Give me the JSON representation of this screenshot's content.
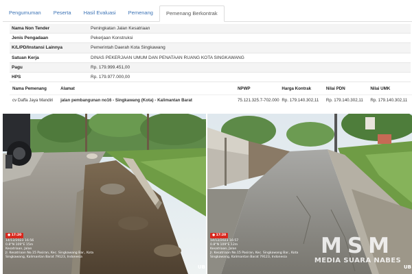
{
  "tabs": [
    {
      "label": "Pengumuman",
      "active": false
    },
    {
      "label": "Peserta",
      "active": false
    },
    {
      "label": "Hasil Evaluasi",
      "active": false
    },
    {
      "label": "Pemenang",
      "active": false
    },
    {
      "label": "Pemenang Berkontrak",
      "active": true
    }
  ],
  "info": [
    {
      "label": "Nama Non Tender",
      "value": "Peningkatan Jalan Kesatriaan"
    },
    {
      "label": "Jenis Pengadaan",
      "value": "Pekerjaan Konstruksi"
    },
    {
      "label": "K/L/PD/Instansi Lainnya",
      "value": "Pemerintah Daerah Kota Singkawang"
    },
    {
      "label": "Satuan Kerja",
      "value": "DINAS PEKERJAAN UMUM DAN PENATAAN RUANG KOTA SINGKAWANG"
    },
    {
      "label": "Pagu",
      "value": "Rp. 179.999.451,00"
    },
    {
      "label": "HPS",
      "value": "Rp. 179.977.000,00"
    }
  ],
  "winner_table": {
    "headers": [
      "Nama Pemenang",
      "Alamat",
      "NPWP",
      "Harga Kontrak",
      "Nilai PDN",
      "Nilai UMK"
    ],
    "rows": [
      {
        "nama": "cv Daffa Jaya Mandiri",
        "alamat": "jalan pembangunan no16 - Singkawang (Kota) - Kalimantan Barat",
        "npwp": "75.121.325.7-702.000",
        "harga": "Rp. 179.140.302,11",
        "pdn": "Rp. 179.140.302,11",
        "umk": "Rp. 179.140.302,11"
      }
    ]
  },
  "photos": {
    "left_stamp": {
      "badge": "● 17:20",
      "lines": [
        "14/12/2023 16:56",
        "0.8°N 109°E 15m",
        "Kesatriaan, Jalan",
        "Jl. Kesatriaan No.15 Pasiran, Kec. Singkawang Bar., Kota",
        "Singkawang, Kalimantan Barat 79123, Indonesia"
      ]
    },
    "right_stamp": {
      "badge": "● 17:20",
      "lines": [
        "14/12/2023 16:57",
        "0.8°N 109°E 12m",
        "Kesatriaan, Jalan",
        "Jl. Kesatriaan No.15 Pasiran, Kec. Singkawang Bar., Kota",
        "Singkawang, Kalimantan Barat 79123, Indonesia"
      ]
    },
    "logo_mark": "UB"
  },
  "watermark": {
    "big": "MSM",
    "small": "MEDIA SUARA NABES"
  },
  "colors": {
    "tab_link": "#3c73b5",
    "stamp_badge": "#d8281e",
    "row_stripe": "#f4f4f4"
  }
}
